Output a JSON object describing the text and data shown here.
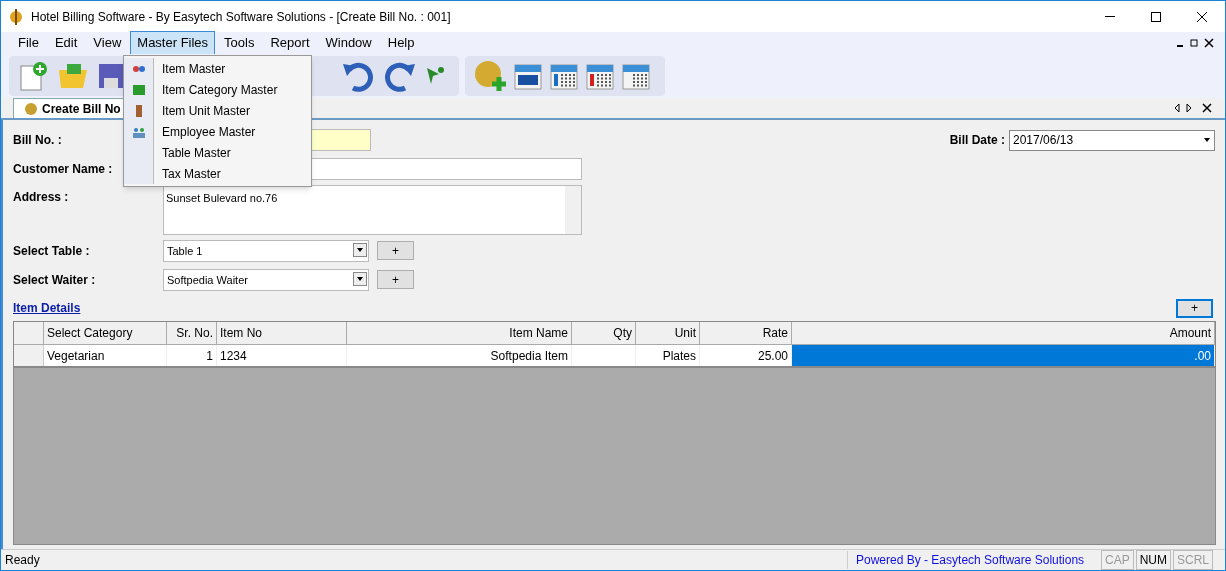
{
  "window": {
    "title": "Hotel Billing Software - By Easytech Software Solutions - [Create Bill No. : 001]"
  },
  "menu": [
    {
      "label": "File",
      "selected": false
    },
    {
      "label": "Edit",
      "selected": false
    },
    {
      "label": "View",
      "selected": false
    },
    {
      "label": "Master Files",
      "selected": true
    },
    {
      "label": "Tools",
      "selected": false
    },
    {
      "label": "Report",
      "selected": false
    },
    {
      "label": "Window",
      "selected": false
    },
    {
      "label": "Help",
      "selected": false
    }
  ],
  "dropdown": [
    "Item Master",
    "Item Category Master",
    "Item Unit Master",
    "Employee Master",
    "Table Master",
    "Tax Master"
  ],
  "tab": {
    "label": "Create Bill No"
  },
  "form": {
    "bill_no_label": "Bill No. :",
    "customer_label": "Customer Name :",
    "address_label": "Address :",
    "address_value": "Sunset Bulevard no.76",
    "table_label": "Select Table :",
    "table_value": "Table 1",
    "waiter_label": "Select Waiter :",
    "waiter_value": "Softpedia Waiter",
    "add_button": "+",
    "bill_date_label": "Bill Date :",
    "bill_date_value": "2017/06/13"
  },
  "item_details": {
    "link": "Item Details",
    "add_button": "+"
  },
  "table": {
    "columns": [
      "Select Category",
      "Sr. No.",
      "Item No",
      "Item Name",
      "Qty",
      "Unit",
      "Rate",
      "Amount"
    ],
    "rows": [
      [
        {
          "text": "Vegetarian",
          "selected": false
        },
        {
          "text": "1",
          "selected": false
        },
        {
          "text": "1234",
          "selected": false
        },
        {
          "text": "Softpedia Item",
          "selected": false
        },
        {
          "text": "",
          "selected": false
        },
        {
          "text": "Plates",
          "selected": false
        },
        {
          "text": "25.00",
          "selected": false
        },
        {
          "text": ".00",
          "selected": true
        }
      ]
    ]
  },
  "status_bar": {
    "text": "Ready",
    "powered": "Powered By - Easytech Software Solutions",
    "keys": [
      {
        "label": "CAP",
        "on": false
      },
      {
        "label": "NUM",
        "on": true
      },
      {
        "label": "SCRL",
        "on": false
      }
    ]
  }
}
